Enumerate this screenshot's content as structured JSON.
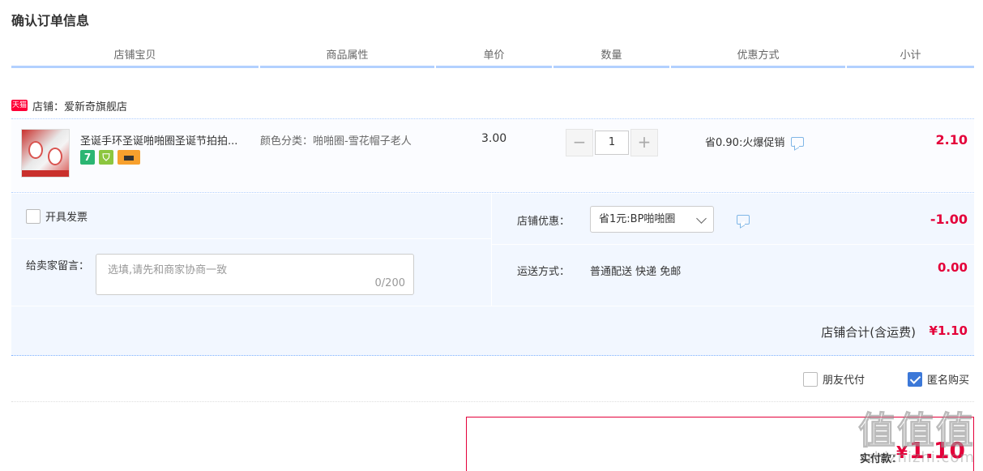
{
  "page_title": "确认订单信息",
  "columns": [
    "店铺宝贝",
    "商品属性",
    "单价",
    "数量",
    "优惠方式",
    "小计"
  ],
  "shop": {
    "badge": "天猫",
    "label": "店铺：爱新奇旗舰店"
  },
  "item": {
    "title": "圣诞手环圣诞啪啪圈圣诞节拍拍...",
    "badges": [
      "7",
      "",
      ""
    ],
    "attribute": "颜色分类：啪啪圈-雪花帽子老人",
    "unit_price": "3.00",
    "quantity": "1",
    "qty_minus": "−",
    "qty_plus": "+",
    "promo": "省0.90:火爆促销",
    "subtotal": "2.10"
  },
  "extras": {
    "invoice_label": "开具发票",
    "invoice_checked": false,
    "message_label": "给卖家留言：",
    "message_placeholder": "选填,请先和商家协商一致",
    "message_count": "0/200",
    "coupon_label": "店铺优惠：",
    "coupon_value": "省1元:BP啪啪圈",
    "coupon_amount": "-1.00",
    "shipping_label": "运送方式：",
    "shipping_value": "普通配送 快递 免邮",
    "shipping_amount": "0.00"
  },
  "shop_total": {
    "label": "店铺合计(含运费)",
    "amount": "¥1.10"
  },
  "options": {
    "friend_pay_label": "朋友代付",
    "friend_pay_checked": false,
    "anonymous_label": "匿名购买",
    "anonymous_checked": true
  },
  "payment": {
    "label": "实付款：",
    "currency": "¥",
    "amount": "1.10"
  },
  "watermark": {
    "logo": "值值值",
    "url": "zhizhizhi.com"
  },
  "colors": {
    "accent_red": "#e4003a",
    "header_border_blue": "#b2d1ff",
    "panel_blue": "#f2f7ff",
    "checkbox_blue": "#3c78d8"
  }
}
